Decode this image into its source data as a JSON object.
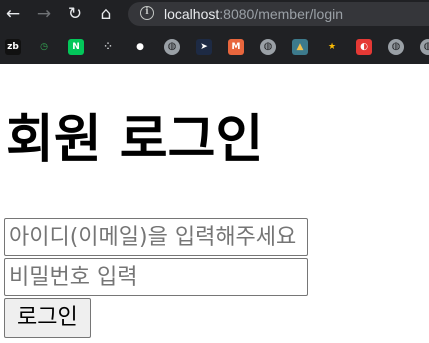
{
  "browser": {
    "toolbar": {
      "back_glyph": "←",
      "forward_glyph": "→",
      "reload_glyph": "↻",
      "home_glyph": "⌂"
    },
    "address_bar": {
      "info_glyph": "i",
      "host": "localhost",
      "rest": ":8080/member/login"
    },
    "bookmarks": [
      {
        "icon": "zb-icon",
        "glyph": "zb",
        "bg": "#111111",
        "fg": "#ffffff"
      },
      {
        "icon": "clock-icon",
        "glyph": "◷",
        "bg": "#202124",
        "fg": "#34a853"
      },
      {
        "icon": "naver-icon",
        "glyph": "N",
        "bg": "#03c75a",
        "fg": "#ffffff"
      },
      {
        "icon": "dots-icon",
        "glyph": "⁘",
        "bg": "#202124",
        "fg": "#e8eaed"
      },
      {
        "icon": "github-icon",
        "glyph": "●",
        "bg": "#202124",
        "fg": "#ffffff"
      },
      {
        "icon": "globe-icon",
        "glyph": "◍",
        "bg": "",
        "fg": ""
      },
      {
        "icon": "bird-icon",
        "glyph": "➤",
        "bg": "#1d2a44",
        "fg": "#ffffff"
      },
      {
        "icon": "m-icon",
        "glyph": "M",
        "bg": "#e8663d",
        "fg": "#ffffff"
      },
      {
        "icon": "globe-icon",
        "glyph": "◍",
        "bg": "",
        "fg": ""
      },
      {
        "icon": "landscape-icon",
        "glyph": "▲",
        "bg": "#3c7a8c",
        "fg": "#f2c14e"
      },
      {
        "icon": "star-icon",
        "glyph": "★",
        "bg": "#202124",
        "fg": "#fbbc04"
      },
      {
        "icon": "ball-icon",
        "glyph": "◐",
        "bg": "#e53935",
        "fg": "#ffffff"
      },
      {
        "icon": "globe-icon",
        "glyph": "◍",
        "bg": "",
        "fg": ""
      },
      {
        "icon": "globe-icon",
        "glyph": "◍",
        "bg": "",
        "fg": ""
      }
    ]
  },
  "page": {
    "title": "회원 로그인",
    "email_field": {
      "value": "",
      "placeholder": "아이디(이메일)을 입력해주세요"
    },
    "password_field": {
      "value": "",
      "placeholder": "비밀번호 입력"
    },
    "login_button_label": "로그인"
  }
}
